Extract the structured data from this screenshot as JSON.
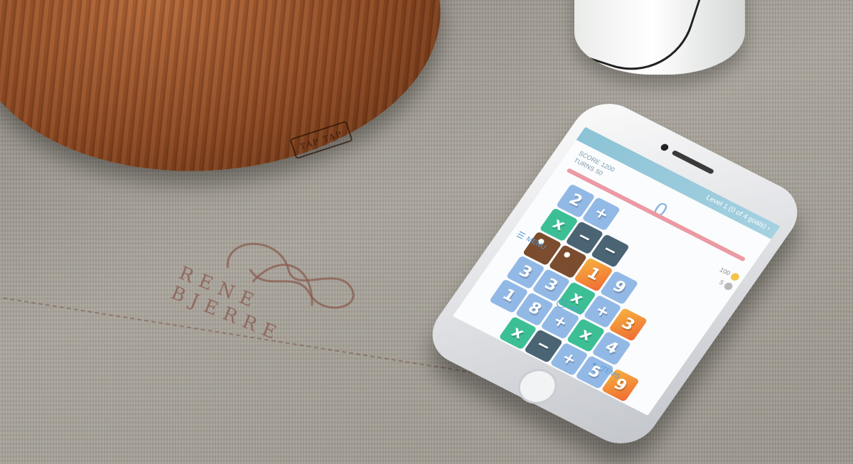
{
  "scene": {
    "board_stamp": "TAP TAP",
    "embroidery_text": "RENE BJERRE"
  },
  "game": {
    "level_label": "Level 1 (0 of 4 goals)",
    "level_chevron": "›",
    "score_label": "SCORE",
    "score_value": "1200",
    "turns_label": "TURNS",
    "turns_value": "50",
    "current_value": "0",
    "coins_value": "100",
    "gems_value": "5",
    "board": [
      [
        {
          "t": "2",
          "c": "blue"
        },
        {
          "t": "+",
          "c": "blue"
        },
        {
          "t": "",
          "c": "empty"
        },
        {
          "t": "",
          "c": "empty"
        },
        {
          "t": "",
          "c": "empty"
        },
        {
          "t": "",
          "c": "empty"
        }
      ],
      [
        {
          "t": "x",
          "c": "green"
        },
        {
          "t": "−",
          "c": "dark"
        },
        {
          "t": "−",
          "c": "dark"
        },
        {
          "t": "",
          "c": "empty"
        },
        {
          "t": "",
          "c": "empty"
        },
        {
          "t": "",
          "c": "empty"
        }
      ],
      [
        {
          "t": "",
          "c": "brown"
        },
        {
          "t": "",
          "c": "brown"
        },
        {
          "t": "1",
          "c": "orange"
        },
        {
          "t": "9",
          "c": "blue"
        },
        {
          "t": "",
          "c": "empty"
        },
        {
          "t": "",
          "c": "empty"
        }
      ],
      [
        {
          "t": "3",
          "c": "blue"
        },
        {
          "t": "3",
          "c": "blue"
        },
        {
          "t": "x",
          "c": "green"
        },
        {
          "t": "+",
          "c": "blue"
        },
        {
          "t": "3",
          "c": "orange"
        },
        {
          "t": "",
          "c": "empty"
        }
      ],
      [
        {
          "t": "1",
          "c": "blue"
        },
        {
          "t": "8",
          "c": "blue"
        },
        {
          "t": "+",
          "c": "blue"
        },
        {
          "t": "x",
          "c": "green"
        },
        {
          "t": "4",
          "c": "blue"
        },
        {
          "t": "",
          "c": "empty"
        }
      ],
      [
        {
          "t": "",
          "c": "empty"
        },
        {
          "t": "x",
          "c": "green"
        },
        {
          "t": "−",
          "c": "dark"
        },
        {
          "t": "+",
          "c": "blue"
        },
        {
          "t": "5",
          "c": "blue"
        },
        {
          "t": "9",
          "c": "orange"
        }
      ]
    ],
    "extra_tile": {
      "t": "+",
      "c": "blue"
    }
  },
  "nav": {
    "menu_label": "MENU",
    "hint_label": "HINT",
    "items_label": "ITEMS"
  },
  "colors": {
    "tile_blue": "#92b9e6",
    "tile_green": "#3dbf95",
    "tile_dark": "#4b6474",
    "tile_orange": "#f39a3a",
    "tile_brown": "#7b4d2e",
    "topbar": "#8cc3d6",
    "progress": "#eb9aa3",
    "accent": "#5b9bd5"
  },
  "icons": {
    "menu": "hamburger-icon",
    "hint": "question-circle-icon",
    "items": "sparkle-wand-icon",
    "coins": "gold-coin-icon",
    "gems": "silver-coin-icon"
  }
}
